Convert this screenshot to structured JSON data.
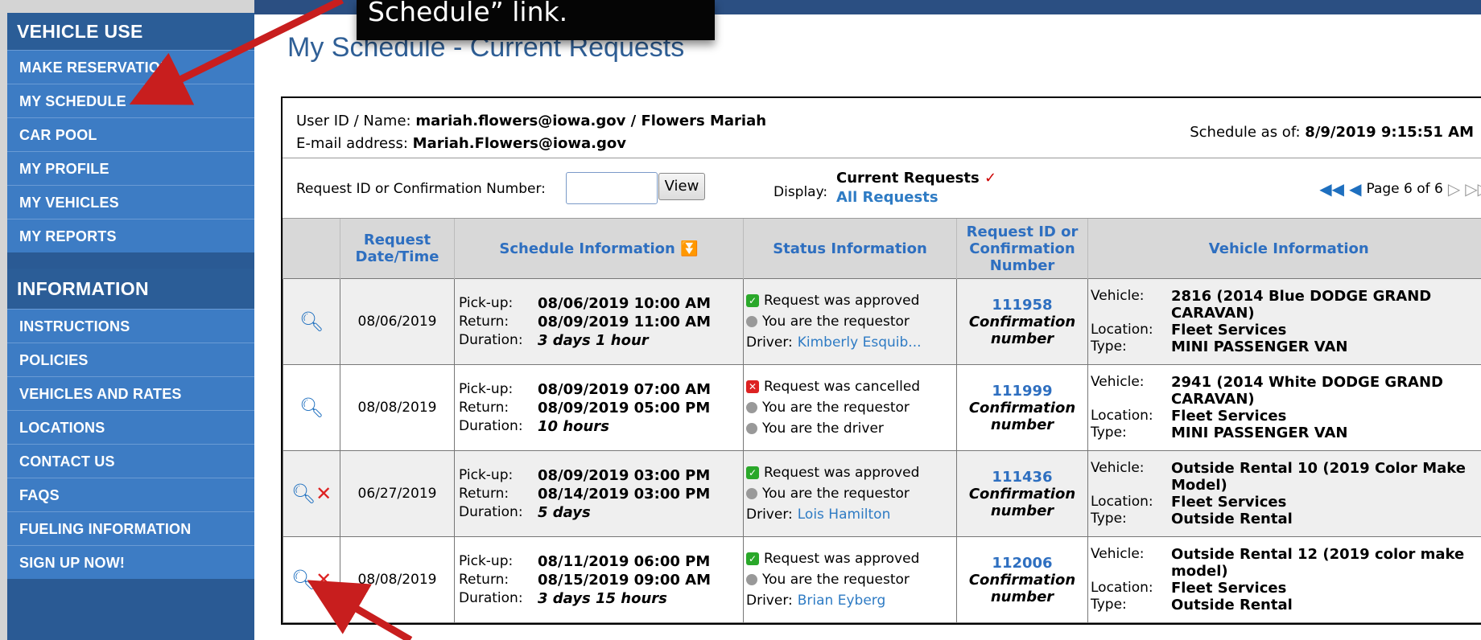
{
  "sidebar": {
    "vehicle_use_title": "VEHICLE USE",
    "vehicle_items": [
      "MAKE RESERVATION",
      "MY SCHEDULE",
      "CAR POOL",
      "MY PROFILE",
      "MY VEHICLES",
      "MY REPORTS"
    ],
    "information_title": "INFORMATION",
    "information_items": [
      "INSTRUCTIONS",
      "POLICIES",
      "VEHICLES AND RATES",
      "LOCATIONS",
      "CONTACT US",
      "FAQS",
      "FUELING INFORMATION",
      "SIGN UP NOW!"
    ]
  },
  "callout": {
    "text": "Schedule” link."
  },
  "page": {
    "title": "My Schedule - Current Requests"
  },
  "user": {
    "id_label": "User ID / Name: ",
    "id_value": "mariah.flowers@iowa.gov / Flowers Mariah",
    "email_label": "E-mail address: ",
    "email_value": "Mariah.Flowers@iowa.gov",
    "schedule_label": "Schedule as of: ",
    "schedule_value": "8/9/2019 9:15:51 AM"
  },
  "controls": {
    "lookup_label": "Request ID or Confirmation Number:",
    "lookup_value": "",
    "view_button": "View",
    "display_label": "Display:",
    "current_requests": "Current Requests",
    "all_requests": "All Requests",
    "page_info": "Page 6 of 6"
  },
  "table": {
    "headers": [
      "Request Date/Time",
      "Schedule Information",
      "Status Information",
      "Request ID or Confirmation Number",
      "Vehicle Information"
    ],
    "labels": {
      "pickup": "Pick-up:",
      "return": "Return:",
      "duration": "Duration:",
      "vehicle": "Vehicle:",
      "location": "Location:",
      "type": "Type:",
      "driver": "Driver: ",
      "confirmation": "Confirmation number"
    },
    "rows": [
      {
        "date": "08/06/2019",
        "pickup": "08/06/2019 10:00 AM",
        "return": "08/09/2019 11:00 AM",
        "duration": "3 days 1 hour",
        "status": "Request was approved",
        "status_icon": "check-icon",
        "requestor": "You are the requestor",
        "driver": "Kimberly Esquib...",
        "id": "111958",
        "vehicle": "2816 (2014 Blue DODGE GRAND CARAVAN)",
        "location": "Fleet Services",
        "type": "MINI PASSENGER VAN"
      },
      {
        "date": "08/08/2019",
        "pickup": "08/09/2019 07:00 AM",
        "return": "08/09/2019 05:00 PM",
        "duration": "10 hours",
        "status": "Request was cancelled",
        "status_icon": "cancel-icon",
        "requestor": "You are the requestor",
        "driver_line": "You are the driver",
        "id": "111999",
        "vehicle": "2941 (2014 White DODGE GRAND CARAVAN)",
        "location": "Fleet Services",
        "type": "MINI PASSENGER VAN"
      },
      {
        "date": "06/27/2019",
        "pickup": "08/09/2019 03:00 PM",
        "return": "08/14/2019 03:00 PM",
        "duration": "5 days",
        "status": "Request was approved",
        "status_icon": "check-icon",
        "requestor": "You are the requestor",
        "driver": "Lois Hamilton",
        "id": "111436",
        "vehicle": "Outside Rental 10 (2019 Color Make Model)",
        "location": "Fleet Services",
        "type": "Outside Rental"
      },
      {
        "date": "08/08/2019",
        "pickup": "08/11/2019 06:00 PM",
        "return": "08/15/2019 09:00 AM",
        "duration": "3 days 15 hours",
        "status": "Request was approved",
        "status_icon": "check-icon",
        "requestor": "You are the requestor",
        "driver": "Brian Eyberg",
        "id": "112006",
        "vehicle": "Outside Rental 12 (2019 color make model)",
        "location": "Fleet Services",
        "type": "Outside Rental"
      }
    ]
  },
  "colors": {
    "sidebar_bg": "#2a5a94",
    "sidebar_item": "#3d7cc4",
    "link": "#2e7bc4",
    "arrow": "#c81e1e"
  }
}
